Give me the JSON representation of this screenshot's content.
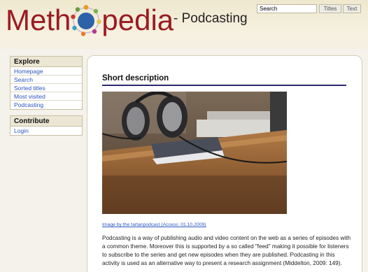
{
  "header": {
    "logo_left": "Meth",
    "logo_right": "pedia",
    "subtitle": "- Podcasting",
    "search_value": "Search",
    "titles_button": "Titles",
    "text_button": "Text"
  },
  "sidebar": {
    "explore": {
      "title": "Explore",
      "items": [
        {
          "label": "Homepage"
        },
        {
          "label": "Search"
        },
        {
          "label": "Sorted titles"
        },
        {
          "label": "Most visited"
        },
        {
          "label": "Podcasting"
        }
      ]
    },
    "contribute": {
      "title": "Contribute",
      "items": [
        {
          "label": "Login"
        }
      ]
    }
  },
  "main": {
    "section_title": "Short description",
    "image_caption": "Image by the tartanpodcast (Access: 01.10.2009)",
    "description": "Podcasting is a way of publishing audio and video content on the web as a series of episodes with a common theme. Moreover this is supported by a so called \"feed\" making it possible for listeners to subscribe to the series and get new episodes when they are published. Podcasting in this activity is used as an alternative way to present a research assignment (Middelton, 2009: 149)."
  },
  "colors": {
    "brand": "#9b1b22",
    "link": "#2a55c0",
    "rule": "#2a2a6e"
  }
}
